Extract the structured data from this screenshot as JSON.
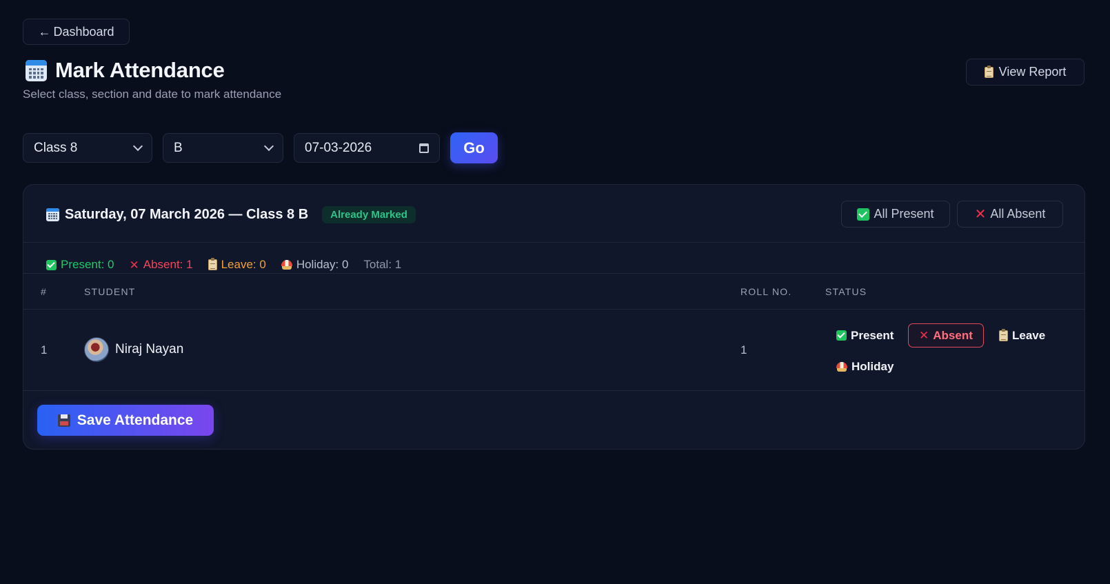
{
  "nav": {
    "back_arrow": "←",
    "back_label": "Dashboard"
  },
  "header": {
    "title": "Mark Attendance",
    "subtitle": "Select class, section and date to mark attendance",
    "report_label": "View Report"
  },
  "filters": {
    "class_value": "Class 8",
    "section_value": "B",
    "date_value": "07-03-2026",
    "go_label": "Go"
  },
  "card": {
    "date_title": "Saturday, 07 March 2026 — Class 8 B",
    "badge": "Already Marked",
    "all_present_label": "All Present",
    "all_absent_label": "All Absent"
  },
  "summary": {
    "present": "Present: 0",
    "absent": "Absent: 1",
    "leave": "Leave: 0",
    "holiday": "Holiday: 0",
    "total": "Total: 1"
  },
  "table": {
    "columns": [
      "#",
      "STUDENT",
      "ROLL NO.",
      "STATUS"
    ],
    "rows": [
      {
        "index": "1",
        "name": "Niraj Nayan",
        "roll": "1",
        "status": "Absent"
      }
    ]
  },
  "status_options": {
    "present": "Present",
    "absent": "Absent",
    "leave": "Leave",
    "holiday": "Holiday"
  },
  "save_label": "Save Attendance",
  "colors": {
    "background": "#090e1c",
    "card": "#10172a",
    "accent": "#2f63f6",
    "present": "#1fc461",
    "absent": "#f0314a",
    "leave": "#f0a13a",
    "badge": "#2ec487"
  },
  "icons": [
    "calendar-icon",
    "clipboard-icon",
    "check-icon",
    "cross-icon",
    "umbrella-icon",
    "floppy-disk-icon",
    "chevron-down-icon"
  ]
}
